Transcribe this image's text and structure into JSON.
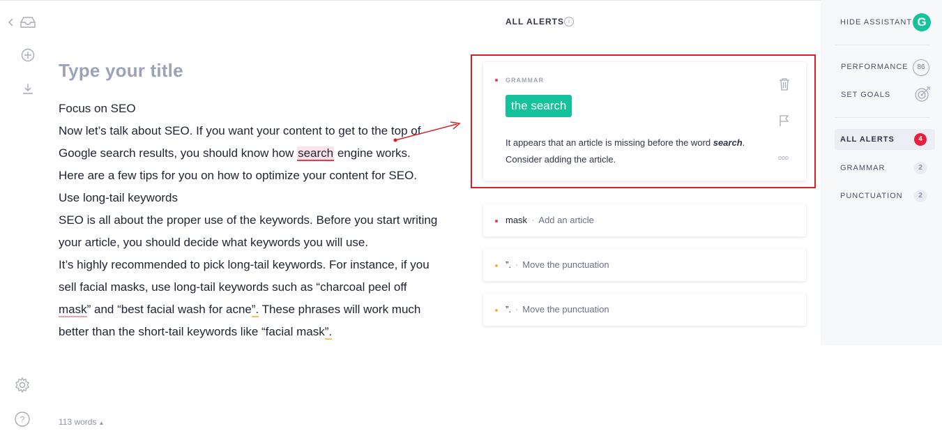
{
  "editor": {
    "title_placeholder": "Type your title",
    "paragraphs": {
      "p1": "Focus on SEO",
      "p2_a": "Now let’s talk about SEO. If you want your content to get to the top of Google search results, you should know how ",
      "p2_hl": "search",
      "p2_b": " engine works. Here are a few tips for you on how to optimize your content for SEO.",
      "p3": "Use long-tail keywords",
      "p4": "SEO is all about the proper use of the keywords. Before you start writing your article, you should decide what keywords you will use.",
      "p5_a": "It’s highly recommended to pick long-tail keywords. For instance, if you sell facial masks, use long-tail keywords such as “charcoal peel off ",
      "p5_mask": "mask",
      "p5_b": "” and “best facial wash for acne",
      "p5_q1": "”.",
      "p5_c": " These phrases will work much better than the short-tail keywords like “facial mask",
      "p5_q2": "”."
    },
    "word_count": "113 words"
  },
  "alerts_panel": {
    "header": "ALL ALERTS",
    "expanded_card": {
      "category": "GRAMMAR",
      "suggestion": "the search",
      "explanation_a": "It appears that an article is missing before the word ",
      "explanation_word": "search",
      "explanation_b": ". Consider adding the article.",
      "more": "ooo"
    },
    "cards": [
      {
        "word": "mask",
        "sep": "·",
        "desc": "Add an article"
      },
      {
        "word": "”.",
        "sep": "·",
        "desc": "Move the punctuation"
      },
      {
        "word": "”.",
        "sep": "·",
        "desc": "Move the punctuation"
      }
    ]
  },
  "assistant": {
    "hide_label": "HIDE ASSISTANT",
    "logo_letter": "G",
    "performance_label": "PERFORMANCE",
    "performance_score": "86",
    "goals_label": "SET GOALS",
    "nav": [
      {
        "label": "ALL ALERTS",
        "count": "4"
      },
      {
        "label": "GRAMMAR",
        "count": "2"
      },
      {
        "label": "PUNCTUATION",
        "count": "2"
      }
    ]
  },
  "colors": {
    "accent_green": "#15c39a",
    "error_red": "#e23b54",
    "warning_yellow": "#f6c350",
    "annotation_red": "#d81f26"
  }
}
